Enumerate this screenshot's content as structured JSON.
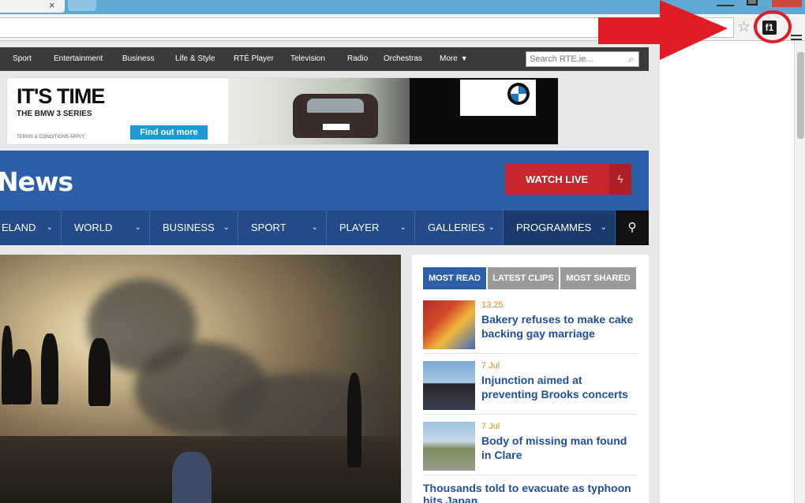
{
  "browser": {
    "tab_close": "×",
    "ext_label": "f1"
  },
  "rte_nav": {
    "items": [
      "Sport",
      "Entertainment",
      "Business",
      "Life & Style",
      "RTÉ Player",
      "Television",
      "Radio",
      "Orchestras",
      "More"
    ],
    "search_placeholder": "Search RTE.ie..."
  },
  "ad": {
    "headline": "IT'S TIME",
    "subline": "THE BMW 3 SERIES",
    "terms": "TERMS & CONDITIONS APPLY",
    "cta": "Find out more"
  },
  "news": {
    "title": "News",
    "watch_live": "WATCH LIVE"
  },
  "sections": [
    "ELAND",
    "WORLD",
    "BUSINESS",
    "SPORT",
    "PLAYER",
    "GALLERIES",
    "PROGRAMMES"
  ],
  "side": {
    "tabs": [
      "MOST READ",
      "LATEST CLIPS",
      "MOST SHARED"
    ],
    "stories": [
      {
        "time": "13.25",
        "title": "Bakery refuses to make cake backing gay marriage"
      },
      {
        "time": "7 Jul",
        "title": "Injunction aimed at preventing Brooks concerts"
      },
      {
        "time": "7 Jul",
        "title": "Body of missing man found in Clare"
      }
    ],
    "extra_story": "Thousands told to evacuate as typhoon hits Japan"
  },
  "colors": {
    "rte_blue": "#2d5ea8",
    "watch_live_red": "#c8262f",
    "annotation_red": "#e01c24"
  }
}
